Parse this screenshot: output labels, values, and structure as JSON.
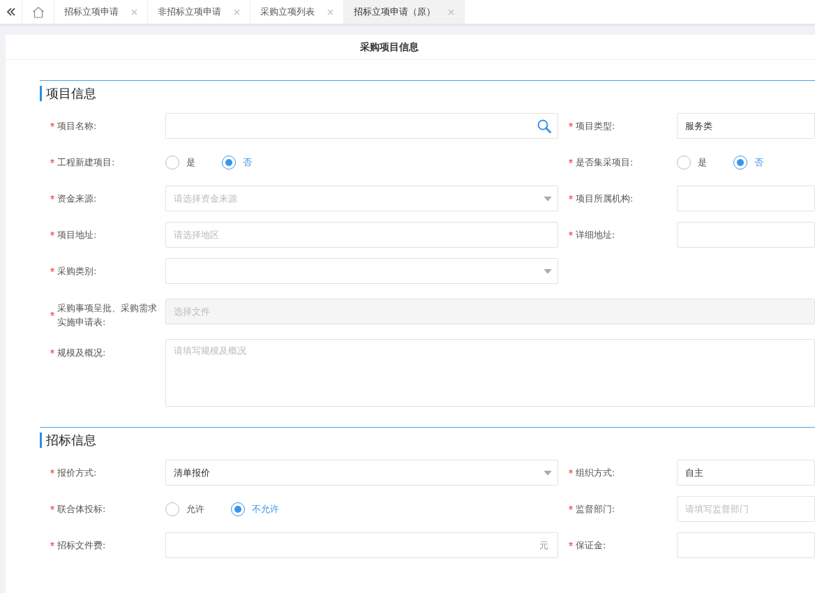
{
  "tab_bar": {
    "tabs": [
      {
        "kind": "home",
        "selected": false
      },
      {
        "kind": "page",
        "label": "招标立项申请",
        "selected": false
      },
      {
        "kind": "page",
        "label": "非招标立项申请",
        "selected": false
      },
      {
        "kind": "page",
        "label": "采购立项列表",
        "selected": false
      },
      {
        "kind": "page",
        "label": "招标立项申请（原）",
        "selected": true
      }
    ]
  },
  "page_title": "采购项目信息",
  "sections": [
    {
      "title": "项目信息",
      "rows": [
        [
          {
            "label": "项目名称:",
            "required": true,
            "kind": "search"
          },
          {
            "label": "项目类型:",
            "required": true,
            "kind": "text",
            "value": "服务类"
          }
        ],
        [
          {
            "label": "工程新建项目:",
            "required": true,
            "kind": "radio",
            "options": [
              {
                "label": "是",
                "selected": false
              },
              {
                "label": "否",
                "selected": true
              }
            ]
          },
          {
            "label": "是否集采项目:",
            "required": true,
            "kind": "radio",
            "options": [
              {
                "label": "是",
                "selected": false
              },
              {
                "label": "否",
                "selected": true
              }
            ]
          }
        ],
        [
          {
            "label": "资金来源:",
            "required": true,
            "kind": "select",
            "placeholder": "请选择资金来源"
          },
          {
            "label": "项目所属机构:",
            "required": true,
            "kind": "text"
          }
        ],
        [
          {
            "label": "项目地址:",
            "required": true,
            "kind": "text",
            "placeholder": "请选择地区"
          },
          {
            "label": "详细地址:",
            "required": true,
            "kind": "text"
          }
        ],
        [
          {
            "label": "采购类别:",
            "required": true,
            "kind": "select"
          }
        ],
        [
          {
            "label": "采购事项呈批、采购需求实施申请表:",
            "required": true,
            "kind": "file",
            "placeholder": "选择文件"
          }
        ],
        [
          {
            "label": "规模及概况:",
            "required": true,
            "kind": "textarea",
            "placeholder": "请填写规模及概况"
          }
        ]
      ]
    },
    {
      "title": "招标信息",
      "rows": [
        [
          {
            "label": "报价方式:",
            "required": true,
            "kind": "select",
            "value": "清单报价"
          },
          {
            "label": "组织方式:",
            "required": true,
            "kind": "text",
            "value": "自主"
          }
        ],
        [
          {
            "label": "联合体投标:",
            "required": true,
            "kind": "radio",
            "options": [
              {
                "label": "允许",
                "selected": false
              },
              {
                "label": "不允许",
                "selected": true
              }
            ]
          },
          {
            "label": "监督部门:",
            "required": true,
            "kind": "text",
            "placeholder": "请填写监督部门"
          }
        ],
        [
          {
            "label": "招标文件费:",
            "required": true,
            "kind": "unit",
            "suffix": "元"
          },
          {
            "label": "保证金:",
            "required": true,
            "kind": "text"
          }
        ]
      ]
    }
  ]
}
